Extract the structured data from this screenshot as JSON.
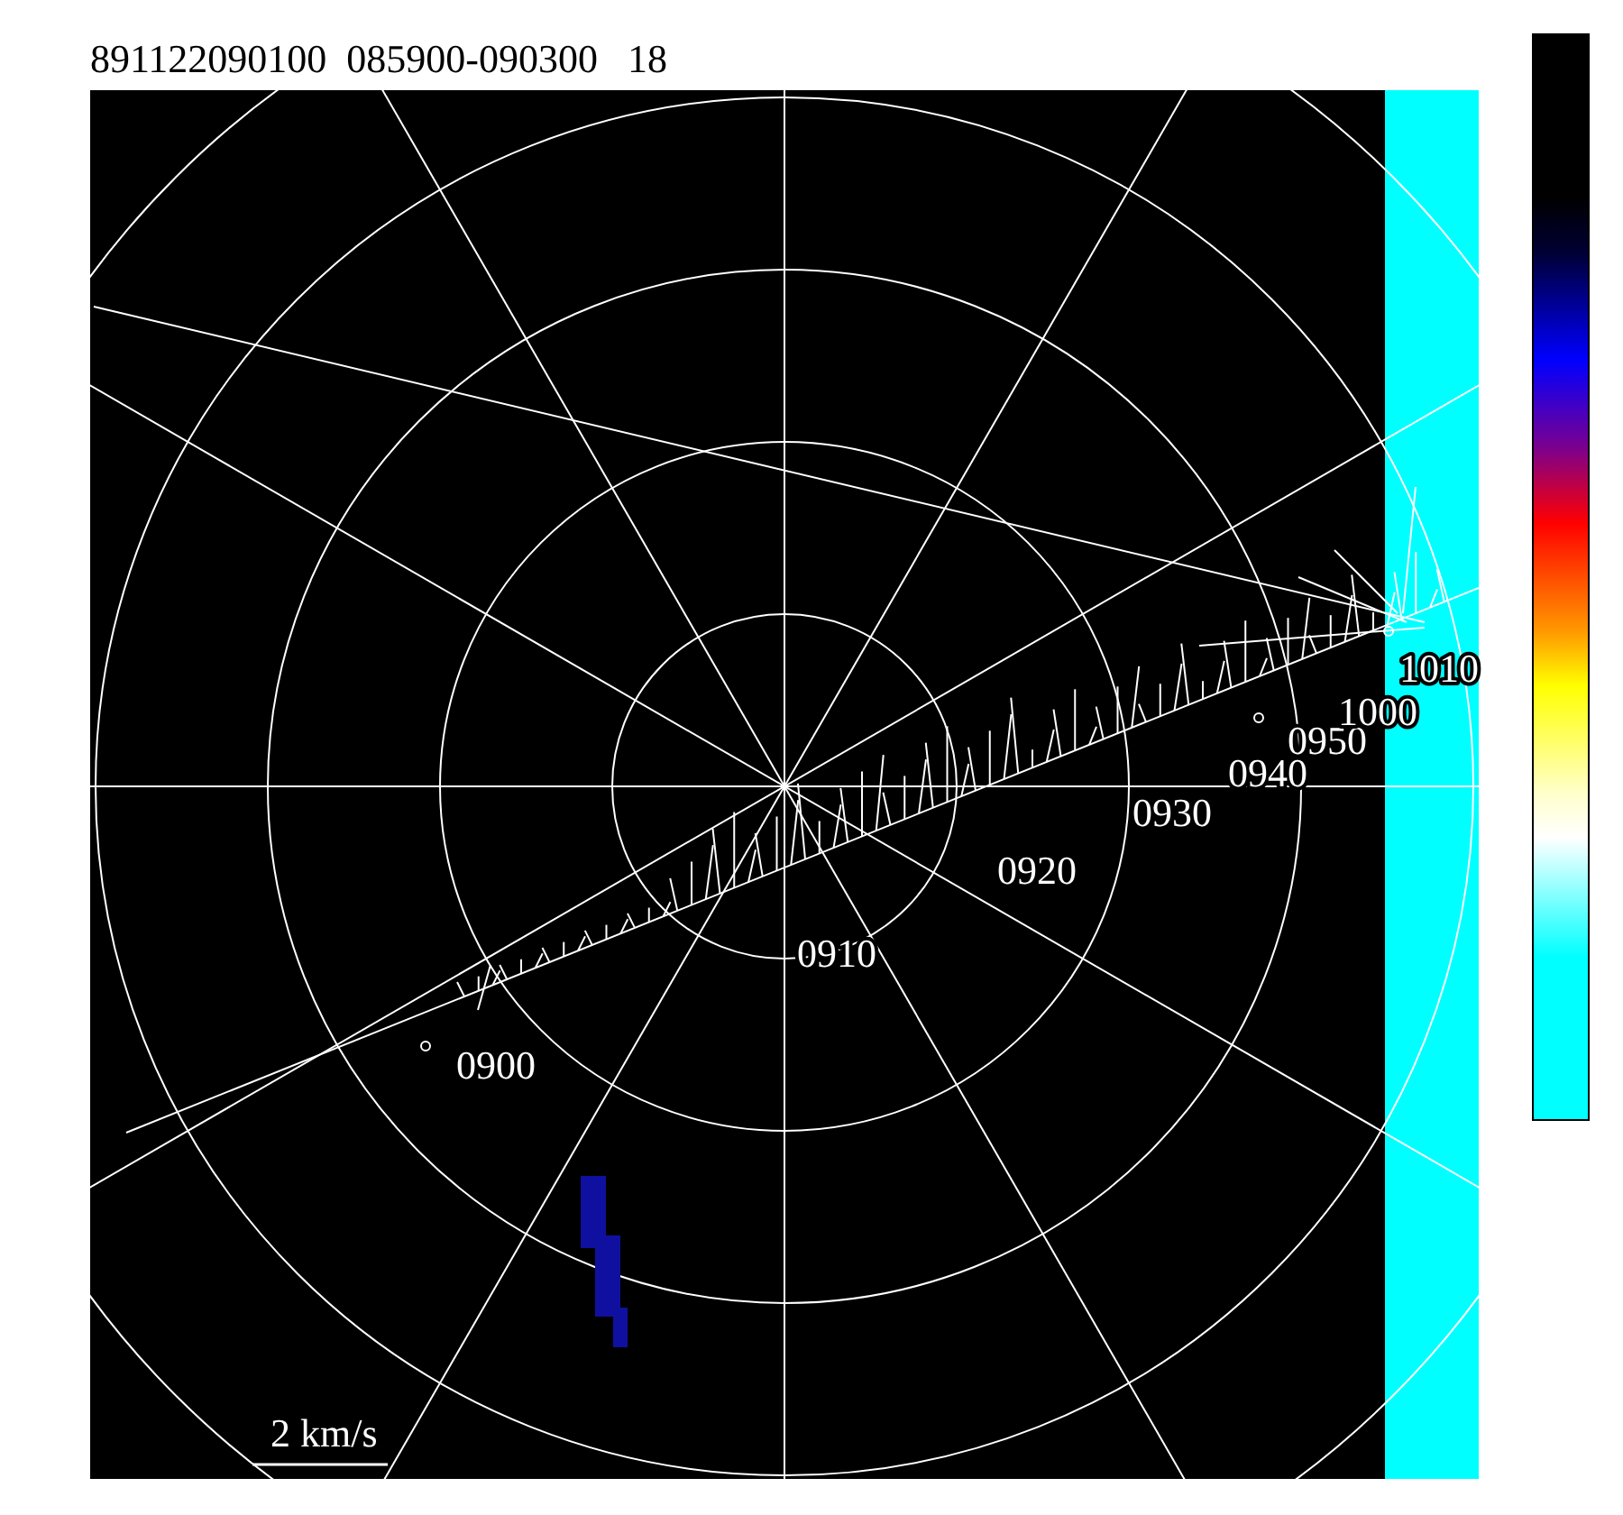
{
  "plot": {
    "title": "891122090100  085900-090300   18",
    "scale_label": "2 km/s",
    "track_labels": [
      {
        "text": "0900"
      },
      {
        "text": "0910"
      },
      {
        "text": "0920"
      },
      {
        "text": "0930"
      },
      {
        "text": "0940"
      },
      {
        "text": "0950"
      },
      {
        "text": "1000"
      },
      {
        "text": "1010"
      }
    ]
  }
}
